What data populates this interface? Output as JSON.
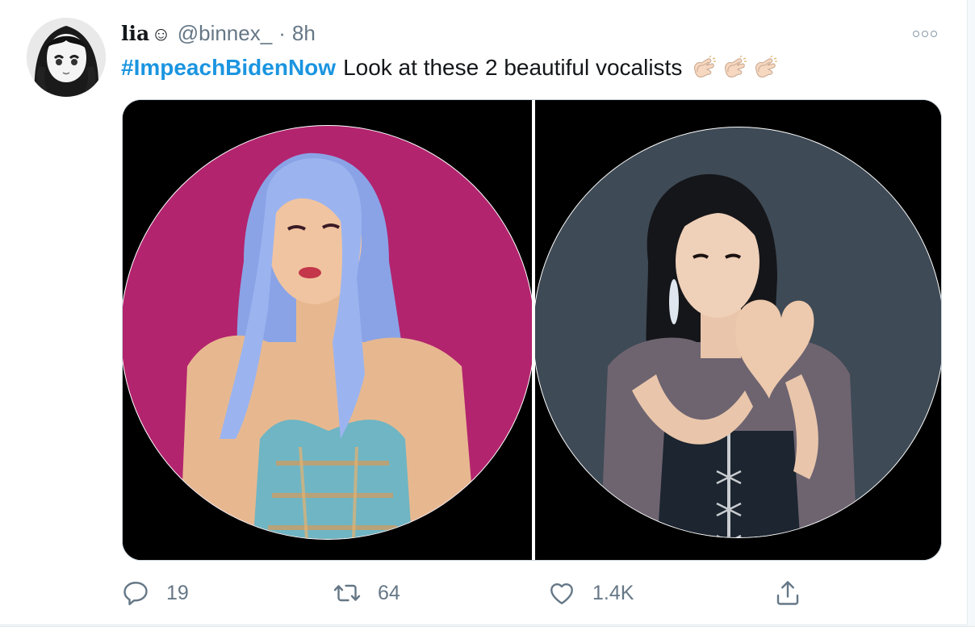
{
  "tweet": {
    "display_name": "lia",
    "name_emoji": "☺",
    "handle": "@binnex_",
    "separator": "·",
    "time": "8h",
    "hashtag": "#ImpeachBidenNow",
    "text": "Look at these 2 beautiful vocalists",
    "text_emoji": [
      "clapping-hands",
      "clapping-hands",
      "clapping-hands"
    ]
  },
  "media": {
    "images": [
      {
        "description_icon": "photo",
        "background": "#b3246e",
        "frame": "circle"
      },
      {
        "description_icon": "photo",
        "background": "#3e4a55",
        "frame": "circle"
      }
    ]
  },
  "actions": {
    "reply_count": "19",
    "retweet_count": "64",
    "like_count": "1.4K"
  },
  "colors": {
    "accent": "#1b95e0",
    "muted": "#657786",
    "text": "#14171a"
  }
}
